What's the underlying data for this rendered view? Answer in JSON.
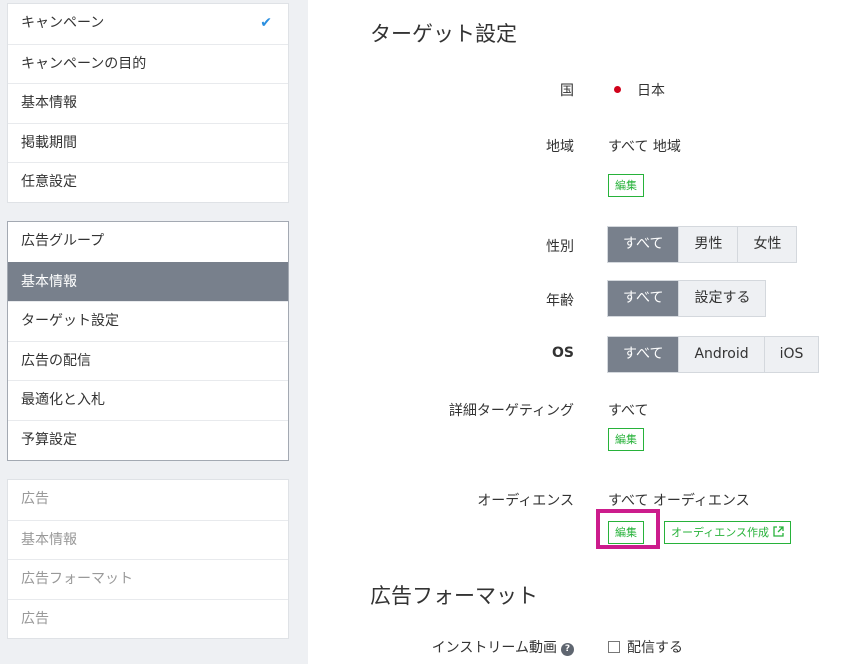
{
  "sidebar": {
    "campaign": [
      {
        "label": "キャンペーン",
        "checked": true
      },
      {
        "label": "キャンペーンの目的"
      },
      {
        "label": "基本情報"
      },
      {
        "label": "掲載期間"
      },
      {
        "label": "任意設定"
      }
    ],
    "ad_group": [
      {
        "label": "広告グループ"
      },
      {
        "label": "基本情報",
        "active": true
      },
      {
        "label": "ターゲット設定"
      },
      {
        "label": "広告の配信"
      },
      {
        "label": "最適化と入札"
      },
      {
        "label": "予算設定"
      }
    ],
    "ad": [
      {
        "label": "広告"
      },
      {
        "label": "基本情報"
      },
      {
        "label": "広告フォーマット"
      },
      {
        "label": "広告"
      }
    ]
  },
  "main": {
    "target_title": "ターゲット設定",
    "country": {
      "label": "国",
      "value": "日本"
    },
    "region": {
      "label": "地域",
      "value": "すべて 地域",
      "edit": "編集"
    },
    "gender": {
      "label": "性別",
      "options": [
        "すべて",
        "男性",
        "女性"
      ],
      "selected": "すべて"
    },
    "age": {
      "label": "年齢",
      "options": [
        "すべて",
        "設定する"
      ],
      "selected": "すべて"
    },
    "os": {
      "label": "OS",
      "options": [
        "すべて",
        "Android",
        "iOS"
      ],
      "selected": "すべて"
    },
    "detailed": {
      "label": "詳細ターゲティング",
      "value": "すべて",
      "edit": "編集"
    },
    "audience": {
      "label": "オーディエンス",
      "value": "すべて オーディエンス",
      "edit": "編集",
      "create": "オーディエンス作成"
    },
    "format_title": "広告フォーマット",
    "instream": {
      "label": "インストリーム動画",
      "checkbox_label": "配信する"
    }
  },
  "colors": {
    "accent_green": "#27b23a",
    "selected_gray": "#78808c",
    "highlight_magenta": "#cc1c8c",
    "check_blue": "#2b8fe0"
  }
}
